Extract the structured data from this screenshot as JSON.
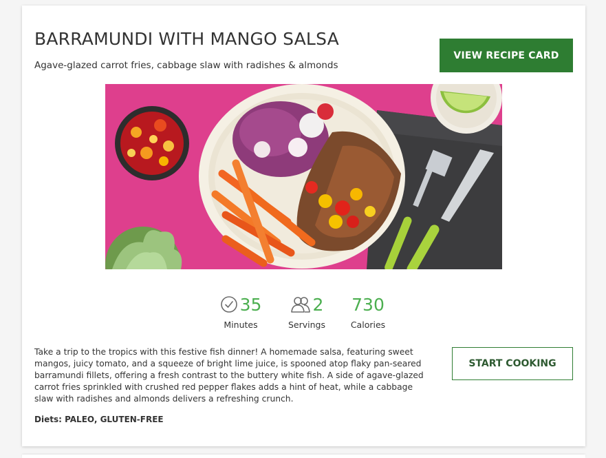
{
  "recipe": {
    "title": "BARRAMUNDI WITH MANGO SALSA",
    "subtitle": "Agave-glazed carrot fries, cabbage slaw with radishes & almonds",
    "view_recipe_card_label": "VIEW RECIPE CARD",
    "start_cooking_label": "START COOKING",
    "description": "Take a trip to the tropics with this festive fish dinner! A homemade salsa, featuring sweet mangos, juicy tomato, and a squeeze of bright lime juice, is spooned atop flaky pan-seared barramundi fillets, offering a fresh contrast to the buttery white fish. A side of agave-glazed carrot fries sprinkled with crushed red pepper flakes adds a hint of heat, while a cabbage slaw with radishes and almonds delivers a refreshing crunch.",
    "diets": "Diets: PALEO, GLUTEN-FREE"
  },
  "stats": {
    "minutes": {
      "value": "35",
      "label": "Minutes",
      "icon": "clock-icon"
    },
    "servings": {
      "value": "2",
      "label": "Servings",
      "icon": "people-icon"
    },
    "calories": {
      "value": "730",
      "label": "Calories"
    }
  },
  "colors": {
    "primary_button": "#2e7d32",
    "stat_value": "#4caf50",
    "text": "#333333",
    "hero_background": "#e2418f"
  }
}
